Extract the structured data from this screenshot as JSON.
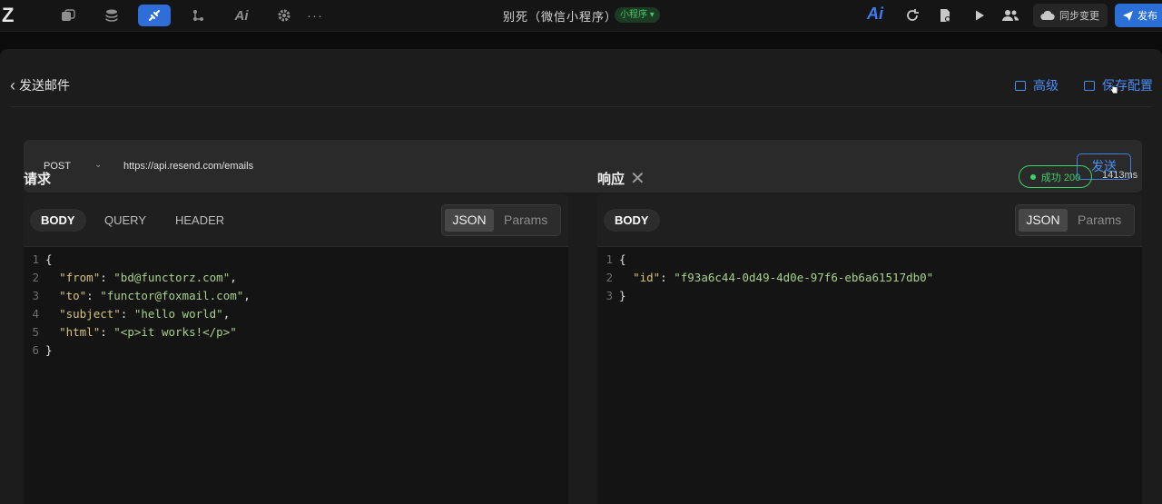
{
  "topbar": {
    "logo": "Z",
    "title": "别死（微信小程序）",
    "badge": "小程序 ▾",
    "ai": "Ai",
    "more": "···",
    "sync_label": "同步变更",
    "publish_label": "发布"
  },
  "page": {
    "back_label": "发送邮件",
    "advanced_label": "高级",
    "save_label": "保存配置"
  },
  "request_bar": {
    "method": "POST",
    "url": "https://api.resend.com/emails",
    "send_label": "发送"
  },
  "request": {
    "title": "请求",
    "tabs": [
      "BODY",
      "QUERY",
      "HEADER"
    ],
    "format_options": [
      "JSON",
      "Params"
    ],
    "lines": [
      {
        "n": "1",
        "parts": [
          {
            "t": "{",
            "c": "p"
          }
        ]
      },
      {
        "n": "2",
        "parts": [
          {
            "t": "  ",
            "c": "p"
          },
          {
            "t": "\"from\"",
            "c": "k"
          },
          {
            "t": ": ",
            "c": "p"
          },
          {
            "t": "\"bd@functorz.com\"",
            "c": "s"
          },
          {
            "t": ",",
            "c": "p"
          }
        ]
      },
      {
        "n": "3",
        "parts": [
          {
            "t": "  ",
            "c": "p"
          },
          {
            "t": "\"to\"",
            "c": "k"
          },
          {
            "t": ": ",
            "c": "p"
          },
          {
            "t": "\"functor@foxmail.com\"",
            "c": "s"
          },
          {
            "t": ",",
            "c": "p"
          }
        ]
      },
      {
        "n": "4",
        "parts": [
          {
            "t": "  ",
            "c": "p"
          },
          {
            "t": "\"subject\"",
            "c": "k"
          },
          {
            "t": ": ",
            "c": "p"
          },
          {
            "t": "\"hello world\"",
            "c": "s"
          },
          {
            "t": ",",
            "c": "p"
          }
        ]
      },
      {
        "n": "5",
        "parts": [
          {
            "t": "  ",
            "c": "p"
          },
          {
            "t": "\"html\"",
            "c": "k"
          },
          {
            "t": ": ",
            "c": "p"
          },
          {
            "t": "\"<p>it works!</p>\"",
            "c": "s"
          }
        ]
      },
      {
        "n": "6",
        "parts": [
          {
            "t": "}",
            "c": "p"
          }
        ]
      }
    ]
  },
  "response": {
    "title": "响应",
    "close": "✕",
    "status": "成功 200",
    "duration": "1413ms",
    "tabs": [
      "BODY"
    ],
    "format_options": [
      "JSON",
      "Params"
    ],
    "lines": [
      {
        "n": "1",
        "parts": [
          {
            "t": "{",
            "c": "p"
          }
        ]
      },
      {
        "n": "2",
        "parts": [
          {
            "t": "  ",
            "c": "p"
          },
          {
            "t": "\"id\"",
            "c": "k"
          },
          {
            "t": ": ",
            "c": "p"
          },
          {
            "t": "\"f93a6c44-0d49-4d0e-97f6-eb6a61517db0\"",
            "c": "s"
          }
        ]
      },
      {
        "n": "3",
        "parts": [
          {
            "t": "}",
            "c": "p"
          }
        ]
      }
    ]
  },
  "colors": {
    "accent": "#4a8df5",
    "success": "#3fd16a",
    "json_key": "#d6c27a",
    "json_string": "#a8d18a"
  }
}
